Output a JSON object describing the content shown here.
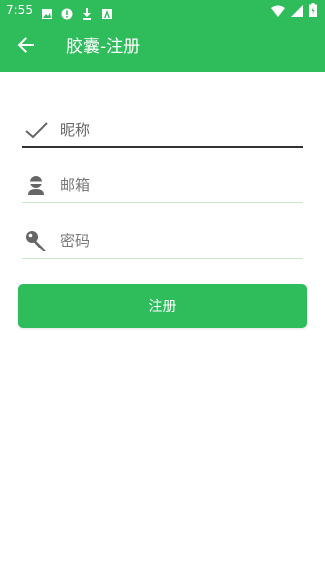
{
  "status_bar": {
    "time": "7:55",
    "left_icons": [
      "image-icon",
      "alert-icon",
      "download-icon",
      "a-icon"
    ],
    "right_icons": [
      "wifi-icon",
      "signal-icon",
      "battery-icon"
    ]
  },
  "toolbar": {
    "back_icon": "arrow-left-icon",
    "title": "胶囊-注册"
  },
  "form": {
    "nickname_placeholder": "昵称",
    "email_placeholder": "邮箱",
    "password_placeholder": "密码",
    "submit_label": "注册"
  },
  "colors": {
    "primary": "#2fbd5c",
    "underline_active": "#333333",
    "underline_inactive": "#c8e8c8",
    "hint_text": "#777777",
    "white": "#ffffff"
  }
}
